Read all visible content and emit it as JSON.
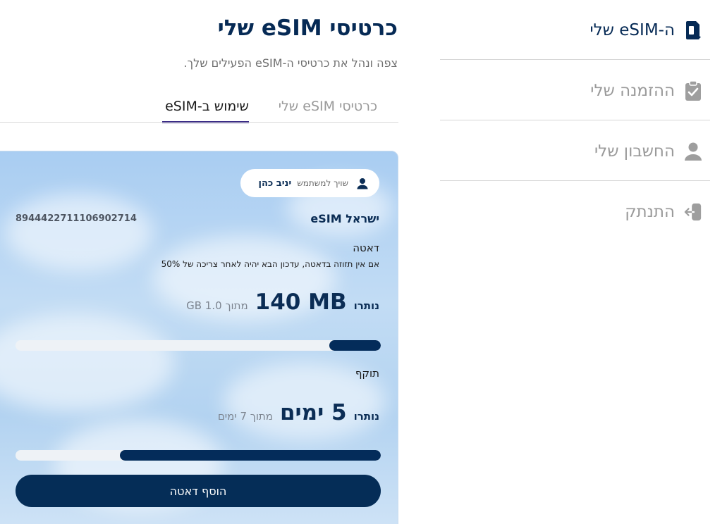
{
  "sidebar": {
    "items": [
      {
        "label": "ה-eSIM שלי",
        "icon": "sim-phone-icon",
        "active": true
      },
      {
        "label": "ההזמנה שלי",
        "icon": "clipboard-check-icon",
        "active": false
      },
      {
        "label": "החשבון שלי",
        "icon": "user-icon",
        "active": false
      },
      {
        "label": "התנתק",
        "icon": "logout-icon",
        "active": false
      }
    ]
  },
  "main": {
    "title": "כרטיסי eSIM שלי",
    "subtitle": "צפה ונהל את כרטיסי ה-eSIM הפעילים שלך.",
    "tabs": [
      {
        "label": "שימוש ב-eSIM",
        "active": true
      },
      {
        "label": "כרטיסי eSIM שלי",
        "active": false
      }
    ]
  },
  "card": {
    "owner_label": "שויך למשתמש",
    "owner_name": "יניב כהן",
    "name": "ישראל eSIM",
    "iccid": "8944422711106902714",
    "data_label": "דאטה",
    "data_note": "אם אין תזוזה בדאטה, עדכון הבא יהיה לאחר צריכה של 50%",
    "data_remaining_prefix": "נותרו",
    "data_remaining_value": "140 MB",
    "data_total": "מתוך GB 1.0",
    "data_fill_fraction": 0.14,
    "validity_label": "תוקף",
    "days_remaining_prefix": "נותרו",
    "days_remaining_value": "5 ימים",
    "days_total": "מתוך 7 ימים",
    "days_fill_fraction": 0.714,
    "add_button": "הוסף דאטה"
  },
  "colors": {
    "brand_navy": "#052d57",
    "tab_underline": "#3a2a86",
    "muted_gray": "#9a9a9a"
  }
}
